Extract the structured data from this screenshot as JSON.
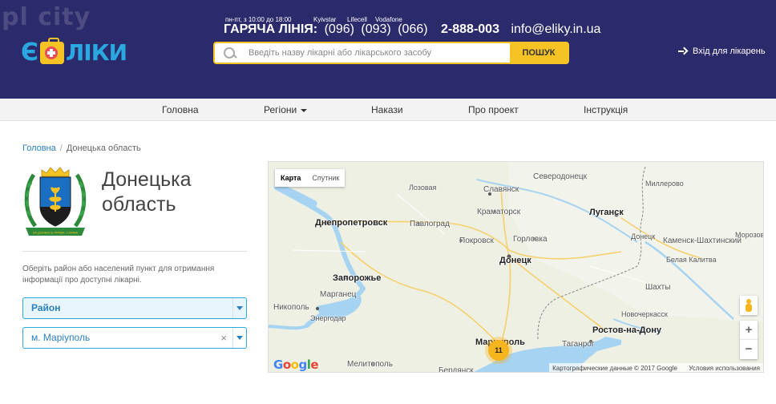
{
  "watermark": "pl city",
  "logo": {
    "left": "Є",
    "right": "ЛІКИ"
  },
  "header": {
    "hours": "пн-пт, з 10:00 до 18:00",
    "operators": [
      "Kyivstar",
      "Lifecell",
      "Vodafone"
    ],
    "hotline_label": "ГАРЯЧА ЛІНІЯ:",
    "phones": [
      "(096)",
      "(093)",
      "(066)"
    ],
    "main_phone": "2-888-003",
    "email": "info@eliky.in.ua",
    "search_placeholder": "Введіть назву лікарні або лікарського засобу",
    "search_button": "ПОШУК",
    "login": "Вхід для лікарень"
  },
  "nav": [
    {
      "label": "Головна"
    },
    {
      "label": "Регіони"
    },
    {
      "label": "Накази"
    },
    {
      "label": "Про проект"
    },
    {
      "label": "Інструкція"
    }
  ],
  "breadcrumb": {
    "home": "Головна",
    "separator": "/",
    "current": "Донецька область"
  },
  "region": {
    "title_line1": "Донецька",
    "title_line2": "область",
    "coat_motto": "ЗА ДОНБАСЬ ПРАВА І СЛАВА"
  },
  "filters": {
    "hint": "Оберіть район або населений пункт для отримання інформації про доступні лікарні.",
    "district": "Район",
    "locality": "м. Маріуполь",
    "clear": "×"
  },
  "map": {
    "type_map": "Карта",
    "type_satellite": "Спутник",
    "zoom_in": "+",
    "zoom_out": "−",
    "cluster_count": "11",
    "google": "Google",
    "attribution": "Картографические данные © 2017 Google",
    "terms": "Условия использования",
    "cities": [
      {
        "name": "Северодонецк"
      },
      {
        "name": "Лозовая"
      },
      {
        "name": "Славянск"
      },
      {
        "name": "Миллерово"
      },
      {
        "name": "Краматорск"
      },
      {
        "name": "Луганск"
      },
      {
        "name": "Днепропетровск"
      },
      {
        "name": "Павлоград"
      },
      {
        "name": "Покровск"
      },
      {
        "name": "Горловка"
      },
      {
        "name": "Донецк"
      },
      {
        "name": "Каменск-Шахтинский"
      },
      {
        "name": "Морозов"
      },
      {
        "name": "Донецк"
      },
      {
        "name": "Белая Калитва"
      },
      {
        "name": "Запорожье"
      },
      {
        "name": "Шахты"
      },
      {
        "name": "Марганец"
      },
      {
        "name": "Никополь"
      },
      {
        "name": "Новочеркасск"
      },
      {
        "name": "Энергодар"
      },
      {
        "name": "Мариуполь"
      },
      {
        "name": "Ростов-на-Дону"
      },
      {
        "name": "Таганрог"
      },
      {
        "name": "Мелитополь"
      },
      {
        "name": "Бердянск"
      }
    ]
  }
}
